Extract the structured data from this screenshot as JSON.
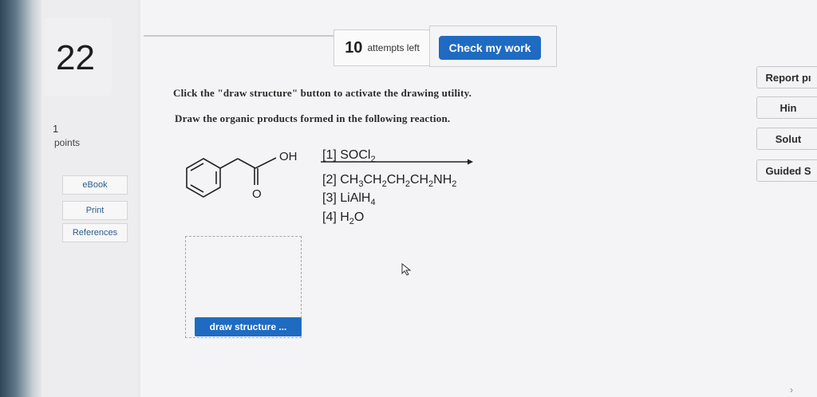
{
  "question": {
    "number": "22",
    "points_value": "1",
    "points_label": "points"
  },
  "sidebar": {
    "items": [
      {
        "label": "eBook"
      },
      {
        "label": "Print"
      },
      {
        "label": "References"
      }
    ]
  },
  "header": {
    "attempts_count": "10",
    "attempts_label": "attempts left",
    "check_label": "Check my work"
  },
  "content": {
    "instruction1": "Click the \"draw structure\" button to activate the drawing utility.",
    "instruction2": "Draw the organic products formed in the following reaction.",
    "molecule": {
      "oh_label": "OH",
      "o_label": "O"
    },
    "reagents": [
      "[1] SOCl2",
      "[2] CH3CH2CH2CH2NH2",
      "[3] LiAlH4",
      "[4] H2O"
    ],
    "draw_button": "draw structure ..."
  },
  "right_panel": {
    "report": "Report pı",
    "hint": "Hin",
    "solution": "Solut",
    "guided": "Guided S"
  },
  "colors": {
    "primary_button": "#1f6bc2",
    "link": "#2d5b8c"
  }
}
